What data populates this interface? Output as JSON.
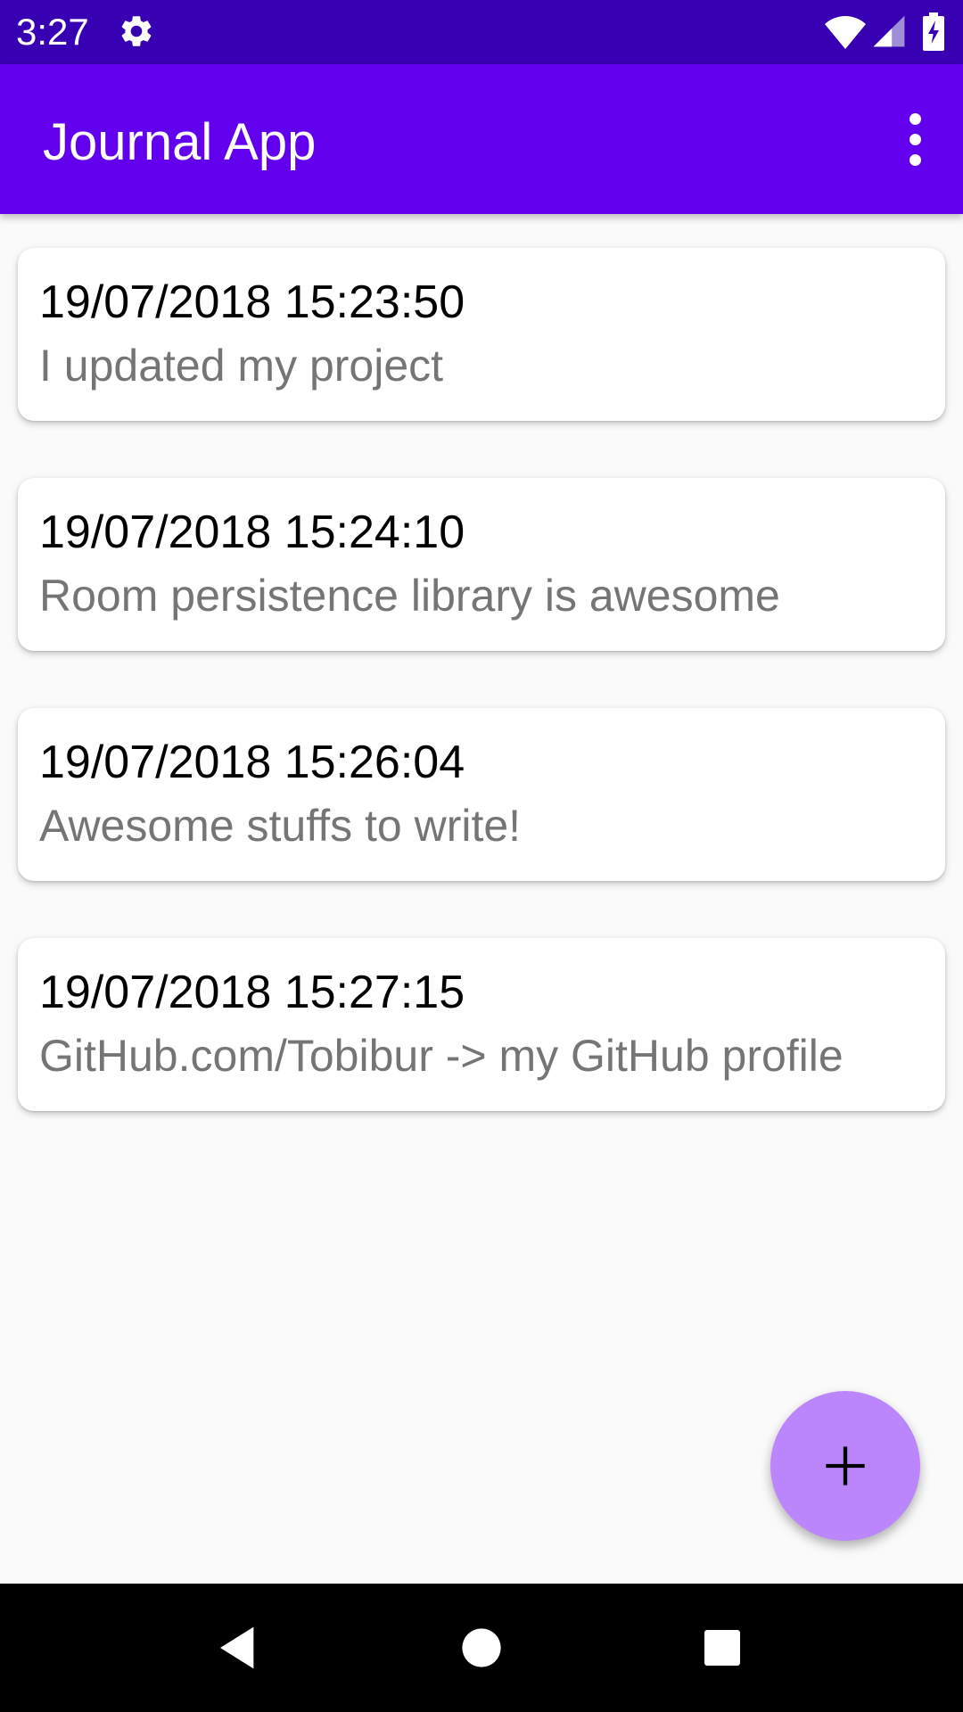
{
  "status_bar": {
    "time": "3:27",
    "icons": [
      "gear-icon",
      "wifi-icon",
      "signal-icon",
      "battery-charging-icon"
    ]
  },
  "app_bar": {
    "title": "Journal App",
    "menu_icon": "overflow-menu-icon"
  },
  "entries": [
    {
      "date": "19/07/2018 15:23:50",
      "text": "I updated my project"
    },
    {
      "date": "19/07/2018 15:24:10",
      "text": "Room persistence library is awesome"
    },
    {
      "date": "19/07/2018 15:26:04",
      "text": "Awesome stuffs to write!"
    },
    {
      "date": "19/07/2018 15:27:15",
      "text": "GitHub.com/Tobibur -> my GitHub profile"
    }
  ],
  "fab": {
    "icon": "plus-icon"
  },
  "nav_bar": {
    "icons": [
      "back-icon",
      "home-icon",
      "recents-icon"
    ]
  },
  "colors": {
    "status_bar": "#3700b3",
    "app_bar": "#6200ee",
    "fab": "#bb86fc",
    "background": "#fafafa"
  }
}
